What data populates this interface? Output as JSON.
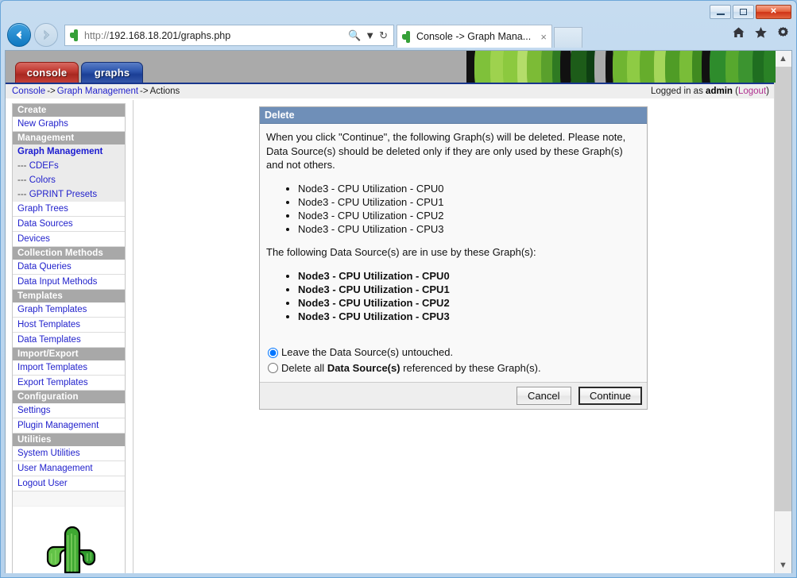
{
  "browser": {
    "url_scheme": "http://",
    "url_rest": "192.168.18.201/graphs.php",
    "search_icon": "search-icon",
    "dropdown_icon": "chevron-down-icon",
    "refresh_icon": "refresh-icon",
    "back_icon": "back-arrow-icon",
    "forward_icon": "forward-arrow-icon",
    "tab_title": "Console -> Graph Mana...",
    "tab_close": "×",
    "minimize_label": "minimize-icon",
    "maximize_label": "maximize-icon",
    "close_label": "✕",
    "home_icon": "home-icon",
    "favorites_icon": "star-icon",
    "tools_icon": "gear-icon"
  },
  "cacti": {
    "tabs": [
      {
        "label": "console",
        "active": false,
        "color": "#b02820"
      },
      {
        "label": "graphs",
        "active": true,
        "color": "#1b3f96"
      }
    ],
    "breadcrumb": {
      "items": [
        "Console",
        "Graph Management",
        "Actions"
      ],
      "separator": "->"
    },
    "session": {
      "prefix": "Logged in as",
      "user": "admin",
      "logout_open": "(",
      "logout": "Logout",
      "logout_close": ")"
    },
    "logo": "cactus-logo"
  },
  "sidebar": {
    "groups": [
      {
        "header": "Create",
        "items": [
          {
            "label": "New Graphs",
            "style": "link"
          }
        ]
      },
      {
        "header": "Management",
        "items": [
          {
            "label": "Graph Management",
            "style": "active"
          },
          {
            "label": "CDEFs",
            "style": "sub",
            "prefix": "--- "
          },
          {
            "label": "Colors",
            "style": "sub",
            "prefix": "--- "
          },
          {
            "label": "GPRINT Presets",
            "style": "sub",
            "prefix": "--- "
          },
          {
            "label": "Graph Trees",
            "style": "link"
          },
          {
            "label": "Data Sources",
            "style": "link"
          },
          {
            "label": "Devices",
            "style": "link"
          }
        ]
      },
      {
        "header": "Collection Methods",
        "items": [
          {
            "label": "Data Queries",
            "style": "link"
          },
          {
            "label": "Data Input Methods",
            "style": "link"
          }
        ]
      },
      {
        "header": "Templates",
        "items": [
          {
            "label": "Graph Templates",
            "style": "link"
          },
          {
            "label": "Host Templates",
            "style": "link"
          },
          {
            "label": "Data Templates",
            "style": "link"
          }
        ]
      },
      {
        "header": "Import/Export",
        "items": [
          {
            "label": "Import Templates",
            "style": "link"
          },
          {
            "label": "Export Templates",
            "style": "link"
          }
        ]
      },
      {
        "header": "Configuration",
        "items": [
          {
            "label": "Settings",
            "style": "link"
          },
          {
            "label": "Plugin Management",
            "style": "link"
          }
        ]
      },
      {
        "header": "Utilities",
        "items": [
          {
            "label": "System Utilities",
            "style": "link"
          },
          {
            "label": "User Management",
            "style": "link"
          },
          {
            "label": "Logout User",
            "style": "link"
          }
        ]
      }
    ]
  },
  "delete_panel": {
    "title": "Delete",
    "intro": "When you click \"Continue\", the following Graph(s) will be deleted. Please note, Data Source(s) should be deleted only if they are only used by these Graph(s) and not others.",
    "graphs": [
      "Node3 - CPU Utilization - CPU0",
      "Node3 - CPU Utilization - CPU1",
      "Node3 - CPU Utilization - CPU2",
      "Node3 - CPU Utilization - CPU3"
    ],
    "datasource_intro": "The following Data Source(s) are in use by these Graph(s):",
    "data_sources": [
      "Node3 - CPU Utilization - CPU0",
      "Node3 - CPU Utilization - CPU1",
      "Node3 - CPU Utilization - CPU2",
      "Node3 - CPU Utilization - CPU3"
    ],
    "options": [
      {
        "label": "Leave the Data Source(s) untouched.",
        "selected": true
      },
      {
        "label_pre": "Delete all ",
        "label_bold": "Data Source(s)",
        "label_post": " referenced by these Graph(s).",
        "selected": false
      }
    ],
    "buttons": {
      "cancel": "Cancel",
      "continue": "Continue"
    }
  },
  "colors": {
    "panel_header": "#6f8fb8",
    "sidebar_section": "#a8a8a8",
    "link": "#2222cc",
    "banner": "#aaaaaa",
    "breadcrumb_rule": "#18368c"
  }
}
